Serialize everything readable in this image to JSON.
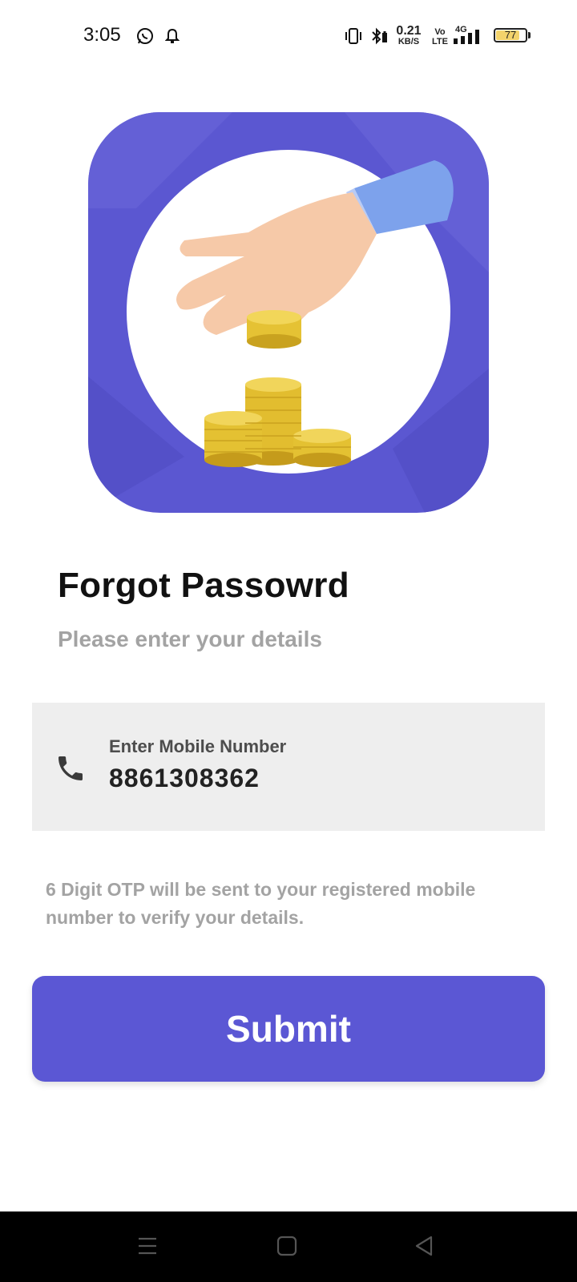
{
  "status_bar": {
    "time": "3:05",
    "net_speed_value": "0.21",
    "net_speed_unit": "KB/S",
    "volte_top": "Vo",
    "volte_bottom": "LTE",
    "network_type": "4G",
    "battery_level": "77",
    "icons": [
      "whatsapp-icon",
      "notification-bell-icon",
      "vibrate-icon",
      "bluetooth-icon",
      "signal-icon",
      "battery-icon"
    ]
  },
  "hero": {
    "image": "hand-placing-coin-on-stacks-illustration",
    "background_color": "#5b57d1"
  },
  "header": {
    "title": "Forgot Passowrd",
    "subtitle": "Please enter your details"
  },
  "mobile_field": {
    "label": "Enter Mobile Number",
    "value": "8861308362",
    "icon": "phone-icon"
  },
  "helper_text": "6 Digit OTP will be sent to your registered mobile number to verify your details.",
  "submit_label": "Submit",
  "nav_bar": {
    "icons": [
      "menu-icon",
      "home-icon",
      "back-icon"
    ]
  },
  "colors": {
    "accent": "#5b57d4",
    "field_bg": "#eeeeee",
    "muted_text": "#a3a3a3"
  }
}
